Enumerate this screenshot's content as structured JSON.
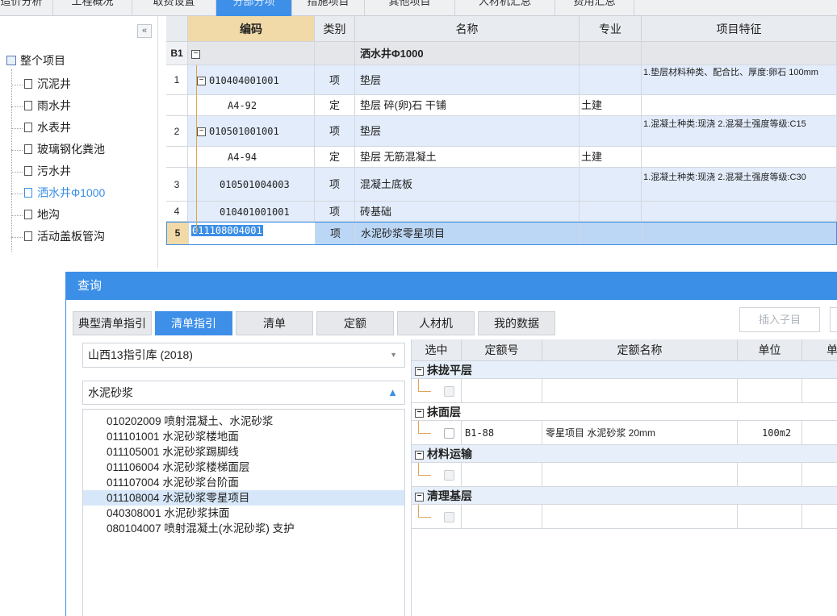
{
  "top_tabs": [
    {
      "label": "造价分析",
      "active": false
    },
    {
      "label": "工程概况",
      "active": false
    },
    {
      "label": "取费设置",
      "active": false
    },
    {
      "label": "分部分项",
      "active": true
    },
    {
      "label": "措施项目",
      "active": false
    },
    {
      "label": "其他项目",
      "active": false
    },
    {
      "label": "人材机汇总",
      "active": false
    },
    {
      "label": "费用汇总",
      "active": false
    }
  ],
  "tree": {
    "collapse_label": "«",
    "root": "整个项目",
    "items": [
      "沉泥井",
      "雨水井",
      "水表井",
      "玻璃钢化粪池",
      "污水井",
      "洒水井Φ1000",
      "地沟",
      "活动盖板管沟"
    ],
    "selected_index": 5
  },
  "grid": {
    "headers": {
      "code": "编码",
      "type": "类别",
      "name": "名称",
      "spec": "专业",
      "feature": "项目特征"
    },
    "section": {
      "rn": "B1",
      "name": "洒水井Φ1000"
    },
    "rows": [
      {
        "rn": "1",
        "code": "010404001001",
        "type": "项",
        "name": "垫层",
        "spec": "",
        "feature": "1.垫层材料种类、配合比、厚度:卵石 100mm"
      },
      {
        "rn": "",
        "code": "A4-92",
        "type": "定",
        "name": "垫层 碎(卵)石 干铺",
        "spec": "土建",
        "feature": ""
      },
      {
        "rn": "2",
        "code": "010501001001",
        "type": "项",
        "name": "垫层",
        "spec": "",
        "feature": "1.混凝土种类:现浇 2.混凝土强度等级:C15"
      },
      {
        "rn": "",
        "code": "A4-94",
        "type": "定",
        "name": "垫层 无筋混凝土",
        "spec": "土建",
        "feature": ""
      },
      {
        "rn": "3",
        "code": "010501004003",
        "type": "项",
        "name": "混凝土底板",
        "spec": "",
        "feature": "1.混凝土种类:现浇 2.混凝土强度等级:C30"
      },
      {
        "rn": "4",
        "code": "010401001001",
        "type": "项",
        "name": "砖基础",
        "spec": "",
        "feature": ""
      },
      {
        "rn": "5",
        "code": "011108004001",
        "type": "项",
        "name": "水泥砂浆零星项目",
        "spec": "",
        "feature": ""
      }
    ]
  },
  "dialog": {
    "title": "查询",
    "tabs": [
      "典型清单指引",
      "清单指引",
      "清单",
      "定额",
      "人材机",
      "我的数据"
    ],
    "active_tab": 1,
    "insert_child": "插入子目",
    "library": "山西13指引库 (2018)",
    "search_value": "水泥砂浆",
    "results": [
      "010202009 喷射混凝土、水泥砂浆",
      "011101001 水泥砂浆楼地面",
      "011105001 水泥砂浆踢脚线",
      "011106004 水泥砂浆楼梯面层",
      "011107004 水泥砂浆台阶面",
      "011108004 水泥砂浆零星项目",
      "040308001 水泥砂浆抹面",
      "080104007 喷射混凝土(水泥砂浆) 支护"
    ],
    "selected_result": 5,
    "right_headers": {
      "select": "选中",
      "quota_no": "定额号",
      "quota_name": "定额名称",
      "unit": "单位",
      "extra": "单"
    },
    "groups": [
      {
        "name": "抹拢平层",
        "row": {
          "quota_no": "",
          "quota_name": "",
          "unit": ""
        }
      },
      {
        "name": "抹面层",
        "row": {
          "quota_no": "B1-88",
          "quota_name": "零星项目 水泥砂浆 20mm",
          "unit": "100m2"
        }
      },
      {
        "name": "材料运输",
        "row": {
          "quota_no": "",
          "quota_name": "",
          "unit": ""
        }
      },
      {
        "name": "清理基层",
        "row": {
          "quota_no": "",
          "quota_name": "",
          "unit": ""
        }
      }
    ]
  },
  "colors": {
    "accent": "#3c8fe6",
    "row_blue": "#e3ecfb",
    "header_orange": "#f2d9a8"
  }
}
